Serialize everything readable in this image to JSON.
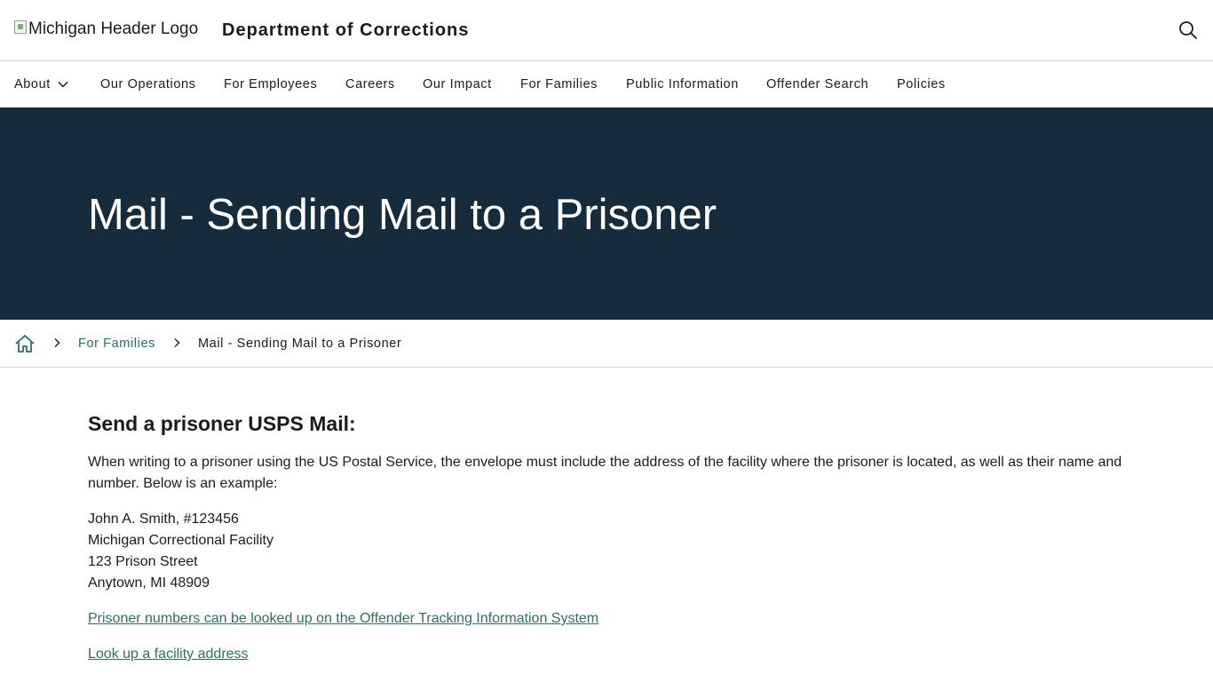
{
  "header": {
    "logo_alt": "Michigan Header Logo",
    "site_title": "Department of Corrections"
  },
  "nav": {
    "items": [
      {
        "label": "About"
      },
      {
        "label": "Our Operations"
      },
      {
        "label": "For Employees"
      },
      {
        "label": "Careers"
      },
      {
        "label": "Our Impact"
      },
      {
        "label": "For Families"
      },
      {
        "label": "Public Information"
      },
      {
        "label": "Offender Search"
      },
      {
        "label": "Policies"
      }
    ]
  },
  "hero": {
    "title": "Mail - Sending Mail to a Prisoner"
  },
  "breadcrumb": {
    "parent": "For Families",
    "current": "Mail - Sending Mail to a Prisoner"
  },
  "content": {
    "heading": "Send a prisoner USPS Mail:",
    "intro": "When writing to a prisoner using the US Postal Service, the envelope must include the address of the facility where the prisoner is located, as well as their name and number. Below is an example:",
    "address": [
      "John A. Smith, #123456",
      "Michigan Correctional Facility",
      "123 Prison Street",
      "Anytown, MI 48909"
    ],
    "link_offender": "Prisoner numbers can be looked up on the Offender Tracking Information System",
    "link_facility": "Look up a facility address"
  },
  "colors": {
    "hero_bg": "#162b3c",
    "link": "#2d6e6a",
    "text": "#1b1b1b",
    "border": "#d6d6d6"
  },
  "icons": {
    "search": "search-icon",
    "home": "home-icon",
    "chevron_down": "chevron-down-icon",
    "chevron_right": "chevron-right-icon"
  }
}
